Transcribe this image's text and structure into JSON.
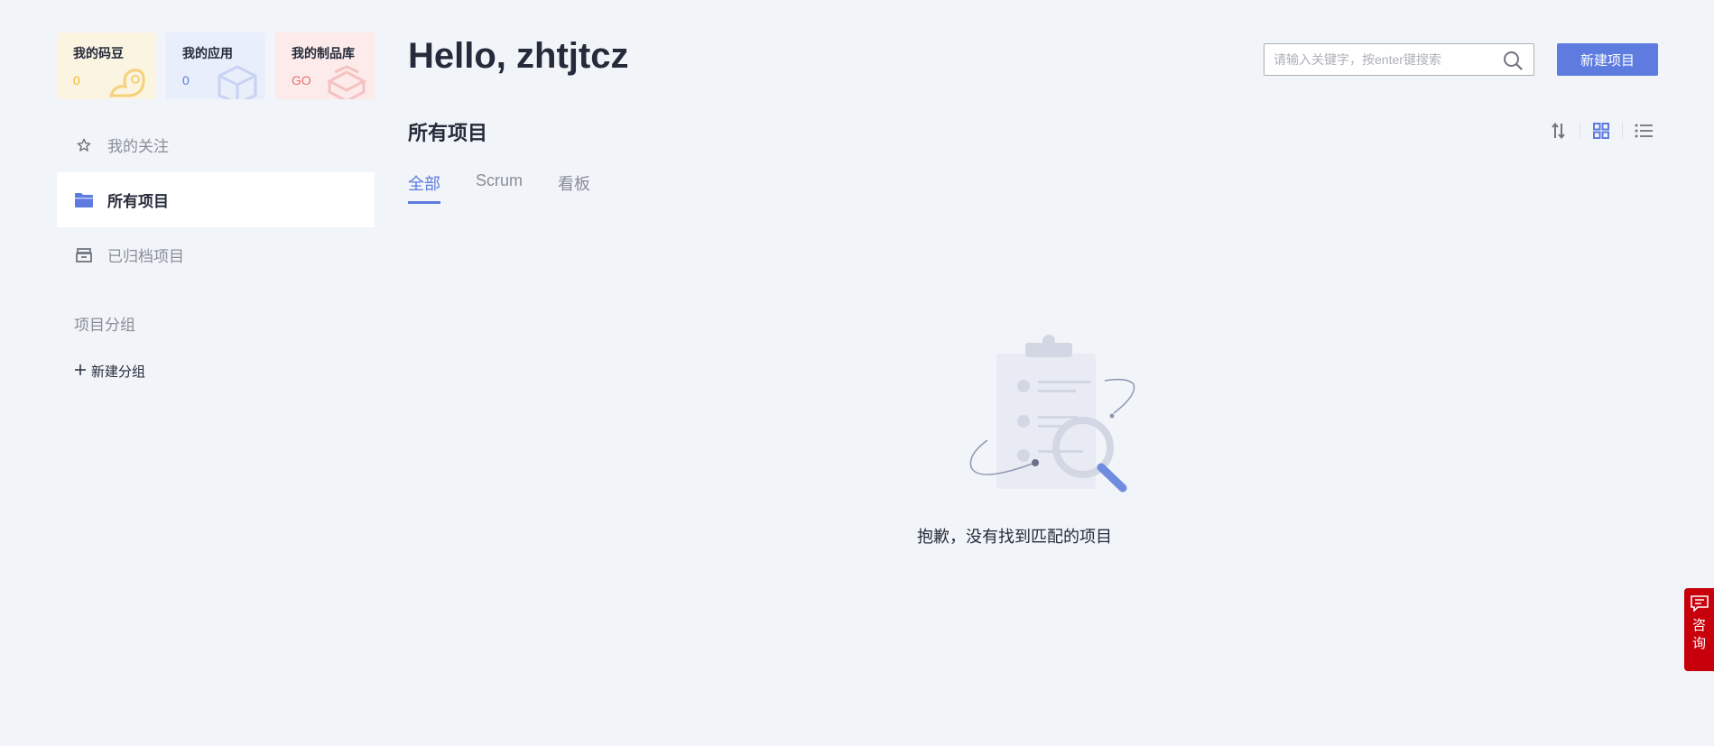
{
  "cards": [
    {
      "title": "我的码豆",
      "value": "0"
    },
    {
      "title": "我的应用",
      "value": "0"
    },
    {
      "title": "我的制品库",
      "value": "GO"
    }
  ],
  "nav": [
    {
      "label": "我的关注",
      "icon": "star-icon"
    },
    {
      "label": "所有项目",
      "icon": "folder-icon",
      "active": true
    },
    {
      "label": "已归档项目",
      "icon": "archive-icon"
    }
  ],
  "groups": {
    "title": "项目分组",
    "new_label": "新建分组"
  },
  "header": {
    "greeting": "Hello, zhtjtcz",
    "search_placeholder": "请输入关键字，按enter键搜索",
    "new_project": "新建项目"
  },
  "section": {
    "title": "所有项目"
  },
  "tabs": [
    {
      "label": "全部",
      "active": true
    },
    {
      "label": "Scrum"
    },
    {
      "label": "看板"
    }
  ],
  "empty": {
    "message": "抱歉，没有找到匹配的项目"
  },
  "consult": {
    "label_1": "咨",
    "label_2": "询"
  },
  "colors": {
    "accent": "#5e7ce0",
    "consult": "#c7000b",
    "background": "#f1f4f8"
  }
}
